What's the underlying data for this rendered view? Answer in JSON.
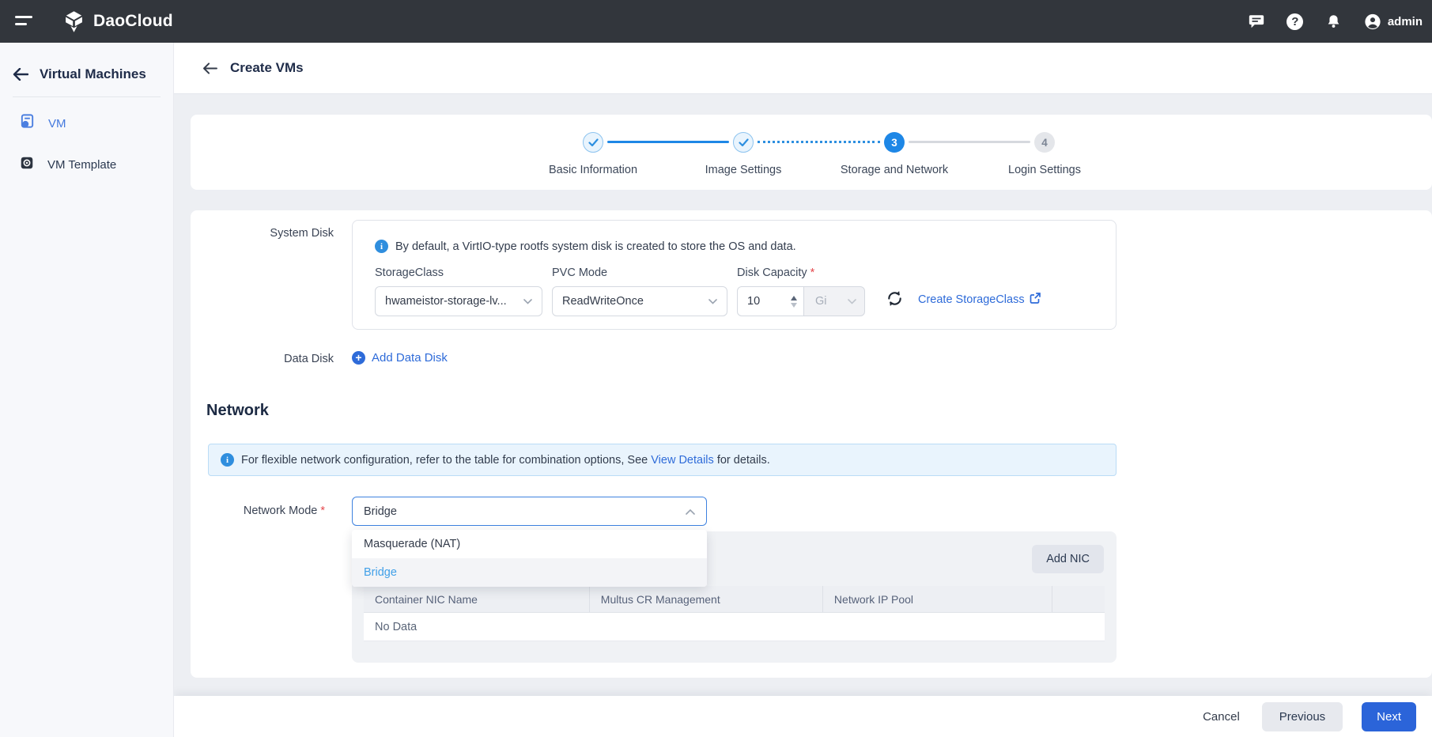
{
  "topbar": {
    "brand": "DaoCloud",
    "user": "admin"
  },
  "sidebar": {
    "title": "Virtual Machines",
    "items": [
      {
        "label": "VM"
      },
      {
        "label": "VM Template"
      }
    ]
  },
  "page_header": {
    "title": "Create VMs"
  },
  "stepper": {
    "steps": [
      {
        "label": "Basic Information",
        "state": "done"
      },
      {
        "label": "Image Settings",
        "state": "done"
      },
      {
        "label": "Storage and Network",
        "state": "active",
        "number": "3"
      },
      {
        "label": "Login Settings",
        "state": "pending",
        "number": "4"
      }
    ]
  },
  "system_disk": {
    "label": "System Disk",
    "info": "By default, a VirtIO-type rootfs system disk is created to store the OS and data.",
    "storage_class": {
      "label": "StorageClass",
      "value": "hwameistor-storage-lv..."
    },
    "pvc_mode": {
      "label": "PVC Mode",
      "value": "ReadWriteOnce"
    },
    "disk_capacity": {
      "label": "Disk Capacity",
      "value": "10",
      "unit": "Gi"
    },
    "create_link": "Create StorageClass"
  },
  "data_disk": {
    "label": "Data Disk",
    "add_link": "Add Data Disk"
  },
  "network": {
    "heading": "Network",
    "banner": {
      "prefix": "For flexible network configuration, refer to the table for combination options, See ",
      "link": "View Details",
      "suffix": " for details."
    },
    "mode": {
      "label": "Network Mode",
      "value": "Bridge"
    },
    "options": [
      {
        "label": "Masquerade (NAT)"
      },
      {
        "label": "Bridge"
      }
    ],
    "nic": {
      "add_button": "Add NIC",
      "columns": [
        "Container NIC Name",
        "Multus CR Management",
        "Network IP Pool"
      ],
      "empty": "No Data"
    }
  },
  "footer": {
    "cancel": "Cancel",
    "previous": "Previous",
    "next": "Next"
  },
  "ui": {
    "required_marker": "*"
  },
  "colors": {
    "topbar_bg": "#32363c",
    "primary_blue": "#1e87e6",
    "link_blue": "#2e6bd9",
    "selected_option_blue": "#41a0e8",
    "required_red": "#e5484d",
    "next_button_blue": "#2b64d9"
  }
}
